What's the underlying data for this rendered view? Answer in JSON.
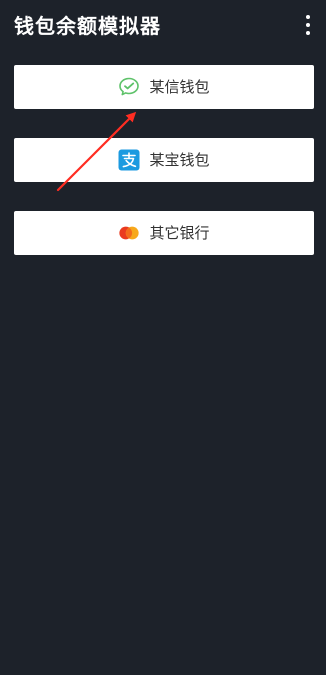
{
  "app": {
    "title": "钱包余额模拟器",
    "menu_icon": "more-vert-icon"
  },
  "wallets": [
    {
      "label": "某信钱包",
      "icon": "wechat-icon",
      "icon_color": "#5ec26a"
    },
    {
      "label": "某宝钱包",
      "icon": "alipay-icon",
      "icon_color": "#1b9ae0"
    },
    {
      "label": "其它银行",
      "icon": "mastercard-icon",
      "icon_color": "#ea3a1f"
    }
  ],
  "colors": {
    "background": "#1d222a",
    "button": "#ffffff",
    "title_text": "#ffffff",
    "label_text": "#333333",
    "annotation_arrow": "#ff2d22"
  }
}
